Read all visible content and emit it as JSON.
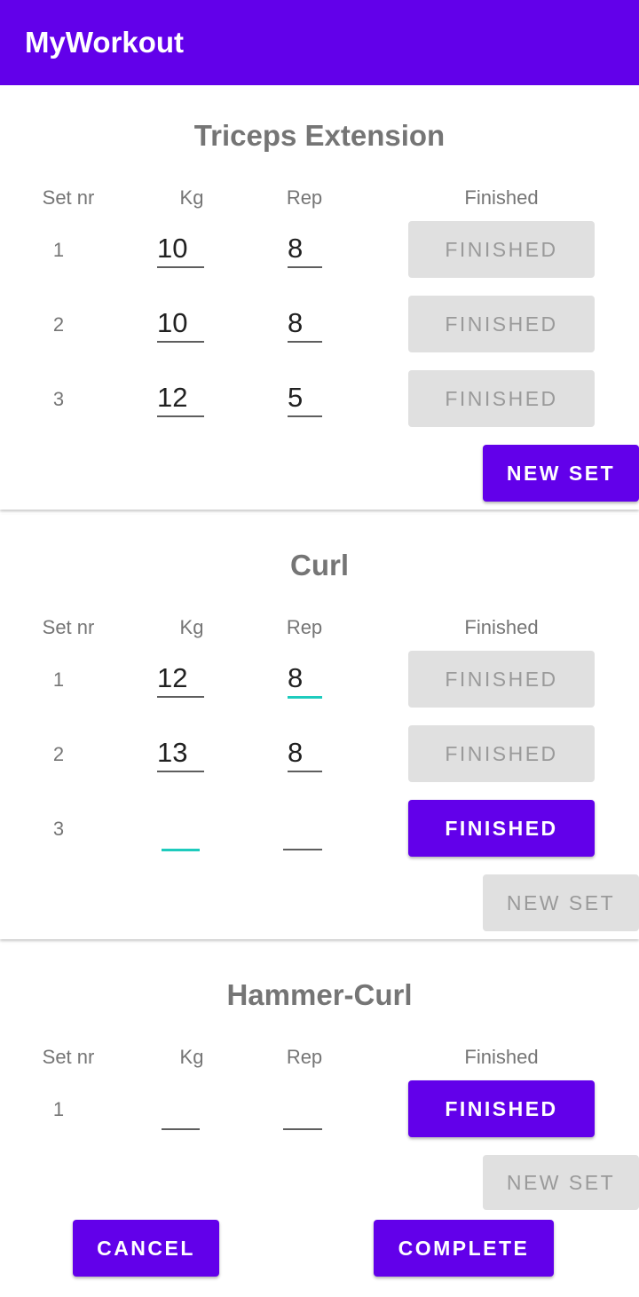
{
  "app": {
    "title": "MyWorkout"
  },
  "headers": {
    "set_nr": "Set nr",
    "kg": "Kg",
    "rep": "Rep",
    "finished": "Finished"
  },
  "exercises": [
    {
      "name": "Triceps Extension",
      "sets": [
        {
          "nr": "1",
          "kg": "10",
          "rep": "8",
          "button": "FINISHED"
        },
        {
          "nr": "2",
          "kg": "10",
          "rep": "8",
          "button": "FINISHED"
        },
        {
          "nr": "3",
          "kg": "12",
          "rep": "5",
          "button": "FINISHED"
        }
      ],
      "new_set": "NEW SET"
    },
    {
      "name": "Curl",
      "sets": [
        {
          "nr": "1",
          "kg": "12",
          "rep": "8",
          "button": "FINISHED"
        },
        {
          "nr": "2",
          "kg": "13",
          "rep": "8",
          "button": "FINISHED"
        },
        {
          "nr": "3",
          "kg": "",
          "rep": "",
          "button": "FINISHED"
        }
      ],
      "new_set": "NEW SET"
    },
    {
      "name": "Hammer-Curl",
      "sets": [
        {
          "nr": "1",
          "kg": "",
          "rep": "",
          "button": "FINISHED"
        }
      ],
      "new_set": "NEW SET"
    }
  ],
  "footer": {
    "cancel": "CANCEL",
    "complete": "COMPLETE"
  },
  "colors": {
    "primary": "#6200ea",
    "focus_underline": "#1ecbbd",
    "disabled_bg": "#e0e0e0"
  }
}
